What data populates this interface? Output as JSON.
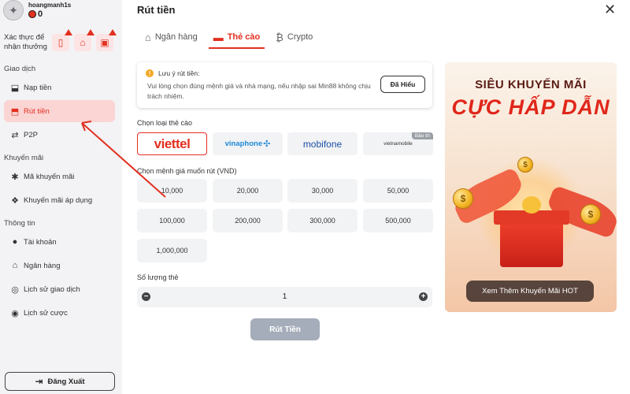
{
  "sidebar": {
    "username": "hoangmanh1s",
    "balance": "0",
    "verify_label": "Xác thực để nhận thưởng",
    "sections": {
      "transactions": "Giao dịch",
      "promotions": "Khuyến mãi",
      "info": "Thông tin"
    },
    "items": {
      "deposit": "Nạp tiền",
      "withdraw": "Rút tiền",
      "p2p": "P2P",
      "promo_code": "Mã khuyến mãi",
      "promo_applied": "Khuyến mãi áp dụng",
      "account": "Tài khoản",
      "bank": "Ngân hàng",
      "tx_history": "Lịch sử giao dịch",
      "bet_history": "Lịch sử cược"
    },
    "logout": "Đăng Xuất"
  },
  "main": {
    "title": "Rút tiền",
    "tabs": [
      "Ngân hàng",
      "Thẻ cào",
      "Crypto"
    ],
    "active_tab": "Thẻ cào",
    "notice": {
      "title": "Lưu ý rút tiền:",
      "text": "Vui lòng chọn đúng mệnh giá và nhà mạng, nếu nhập sai Min88 không chịu trách nhiệm.",
      "button": "Đã Hiểu"
    },
    "carrier_label": "Chọn loại thẻ cào",
    "carriers": {
      "viettel": "viettel",
      "vinaphone": "vinaphone",
      "mobifone": "mobifone",
      "vietnamobile": "vietnamobile",
      "maintenance_badge": "Bảo trì"
    },
    "selected_carrier": "viettel",
    "amount_label": "Chọn mệnh giá muốn rút (VND)",
    "amounts": [
      "10,000",
      "20,000",
      "30,000",
      "50,000",
      "100,000",
      "200,000",
      "300,000",
      "500,000",
      "1,000,000"
    ],
    "quantity_label": "Số lượng thẻ",
    "quantity": "1",
    "submit": "Rút Tiền"
  },
  "promo": {
    "line1": "SIÊU KHUYẾN MÃI",
    "line2": "CỰC HẤP DẪN",
    "button": "Xem Thêm Khuyến Mãi HOT"
  },
  "colors": {
    "accent": "#e2301f",
    "active_bg": "#fbd4d4",
    "disabled_button": "#a5adba",
    "annotation_arrow": "#e2301f"
  }
}
